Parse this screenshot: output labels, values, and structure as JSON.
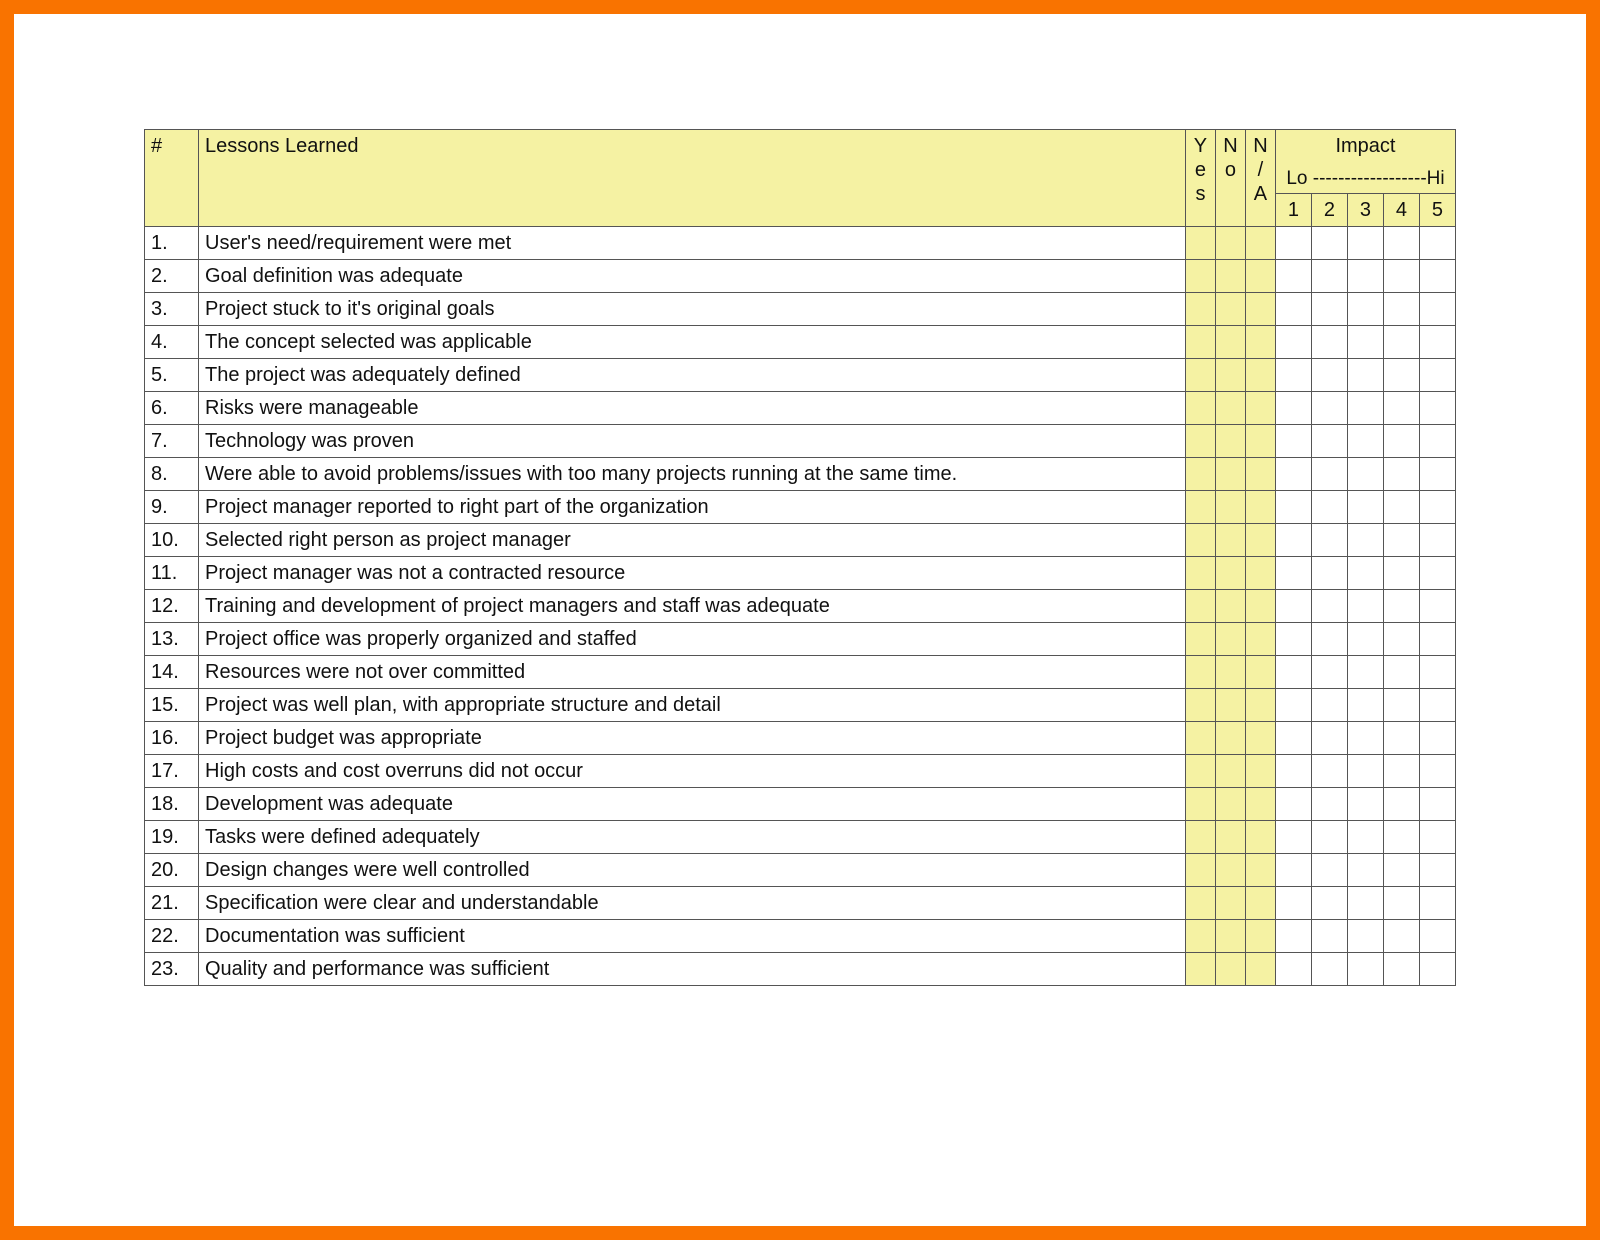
{
  "header": {
    "num": "#",
    "lessons": "Lessons Learned",
    "yes": "Yes",
    "no": "No",
    "na": "N/A",
    "impact": "Impact",
    "scale": "Lo ------------------Hi",
    "levels": [
      "1",
      "2",
      "3",
      "4",
      "5"
    ]
  },
  "rows": [
    {
      "n": "1.",
      "t": "User's need/requirement were met"
    },
    {
      "n": "2.",
      "t": "Goal definition was adequate"
    },
    {
      "n": "3.",
      "t": "Project stuck to it's original goals"
    },
    {
      "n": "4.",
      "t": "The concept selected was applicable"
    },
    {
      "n": "5.",
      "t": "The project was adequately defined"
    },
    {
      "n": "6.",
      "t": "Risks were manageable"
    },
    {
      "n": "7.",
      "t": "Technology was proven"
    },
    {
      "n": "8.",
      "t": "Were able to avoid problems/issues with too many projects running at the same time."
    },
    {
      "n": "9.",
      "t": "Project manager reported to right part of the organization"
    },
    {
      "n": "10.",
      "t": "Selected right person as project manager"
    },
    {
      "n": "11.",
      "t": "Project manager was not a contracted resource"
    },
    {
      "n": "12.",
      "t": "Training and development of project managers and staff was adequate"
    },
    {
      "n": "13.",
      "t": "Project office was properly organized and staffed"
    },
    {
      "n": "14.",
      "t": "Resources were not over committed"
    },
    {
      "n": "15.",
      "t": "Project was well plan, with appropriate structure and detail"
    },
    {
      "n": "16.",
      "t": "Project budget was appropriate"
    },
    {
      "n": "17.",
      "t": "High costs and cost overruns did not occur"
    },
    {
      "n": "18.",
      "t": "Development was adequate"
    },
    {
      "n": "19.",
      "t": "Tasks were defined adequately"
    },
    {
      "n": "20.",
      "t": "Design changes were well controlled"
    },
    {
      "n": "21.",
      "t": "Specification were clear and understandable"
    },
    {
      "n": "22.",
      "t": "Documentation was sufficient"
    },
    {
      "n": "23.",
      "t": "Quality and performance was sufficient"
    }
  ]
}
